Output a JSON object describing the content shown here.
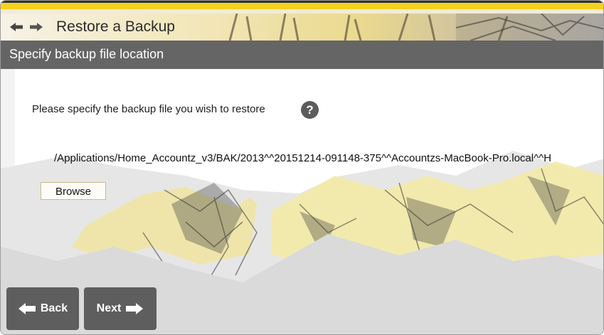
{
  "window": {
    "title": "Restore a Backup",
    "section": "Specify backup file location"
  },
  "nav": {
    "back_icon": "left-arrow-icon",
    "forward_icon": "right-arrow-icon"
  },
  "main": {
    "prompt": "Please specify the backup file you wish to restore",
    "help_icon": "question-mark-icon",
    "help_glyph": "?",
    "file_path": "/Applications/Home_Accountz_v3/BAK/2013^^20151214-091148-375^^Accountzs-MacBook-Pro.local^^H",
    "browse_label": "Browse"
  },
  "footer": {
    "back_label": "Back",
    "next_label": "Next"
  },
  "colors": {
    "accent_yellow": "#f5d21f",
    "header_gray": "#656565",
    "button_gray": "#5e5e5e",
    "mountain_gray": "#dadada"
  }
}
